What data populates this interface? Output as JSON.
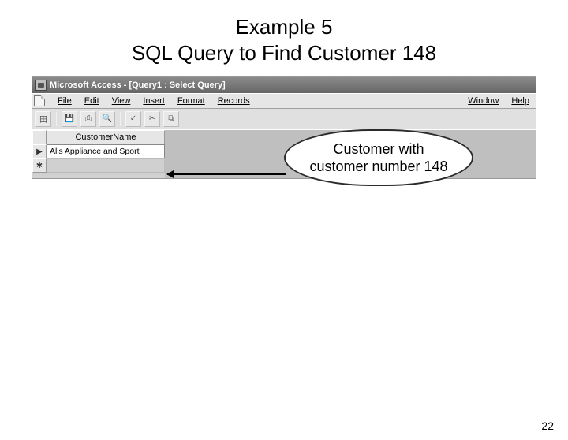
{
  "slide": {
    "title_line1": "Example 5",
    "title_line2": "SQL Query to Find Customer 148",
    "page_number": "22"
  },
  "titlebar": {
    "text": "Microsoft Access - [Query1 : Select Query]"
  },
  "menus": {
    "file": "File",
    "edit": "Edit",
    "view": "View",
    "insert": "Insert",
    "format": "Format",
    "records": "Records",
    "window": "Window",
    "help": "Help"
  },
  "datasheet": {
    "column_header": "CustomerName",
    "row1_value": "Al's Appliance and Sport",
    "current_marker": "▶",
    "new_marker": "✱"
  },
  "callout": {
    "line1": "Customer with",
    "line2": "customer number 148"
  }
}
